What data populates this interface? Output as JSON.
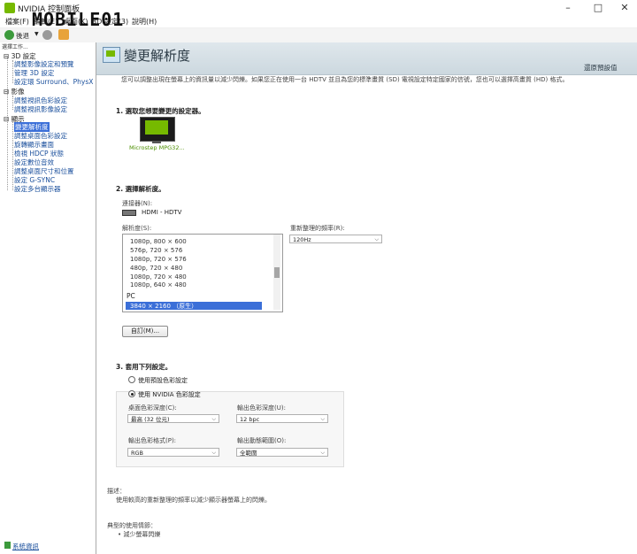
{
  "window": {
    "title": "NVIDIA 控制面板",
    "minimize": "–",
    "maximize": "□",
    "close": "✕"
  },
  "watermark": "MOBILE01",
  "menu": {
    "file": "檔案(F)",
    "edit": "編輯(E)",
    "view": "桌面(K)",
    "three_d": "3D 設定(3)",
    "help": "說明(H)"
  },
  "toolbar": {
    "back_label": "後退"
  },
  "sidebar": {
    "task_label": "選擇工作...",
    "categories": [
      {
        "label": "3D 設定",
        "items": [
          "調整影像設定和預覽",
          "管理 3D 設定",
          "設定環 Surround、PhysX"
        ]
      },
      {
        "label": "影像",
        "items": [
          "調整視訊色彩設定",
          "調整視訊影像設定"
        ]
      },
      {
        "label": "顯示",
        "items": [
          "變更解析度",
          "調整桌面色彩設定",
          "旋轉顯示畫面",
          "檢視 HDCP 狀態",
          "設定數位音效",
          "調整桌面尺寸和位置",
          "設定 G-SYNC",
          "設定多台顯示器"
        ]
      }
    ],
    "system_info": "系統資訊"
  },
  "main": {
    "title": "變更解析度",
    "restore_defaults": "還原預設值",
    "intro": "您可以調整出現在螢幕上的資訊量以減少閃爍。如果您正在使用一台 HDTV 並且為您的標準畫質 (SD) 電視設定特定國家的信號，您也可以選擇高畫質 (HD) 格式。",
    "section1": {
      "title": "1. 選取您想要變更的設定器。",
      "monitor_name": "Microstep MPG32..."
    },
    "section2": {
      "title": "2. 選擇解析度。",
      "connector_label": "連接器(N):",
      "connector_value": "HDMI - HDTV",
      "resolution_label": "解析度(S):",
      "resolutions": [
        "1080p, 800 × 600",
        "576p, 720 × 576",
        "1080p, 720 × 576",
        "480p, 720 × 480",
        "1080p, 720 × 480",
        "1080p, 640 × 480"
      ],
      "pc_group": "PC",
      "selected_resolution": "3840 × 2160 （原生）",
      "refresh_label": "重新整理的頻率(R):",
      "refresh_value": "120Hz",
      "customize_button": "自訂(M)..."
    },
    "section3": {
      "title": "3. 套用下列設定。",
      "radio_default": "使用預設色彩設定",
      "radio_nvidia": "使用 NVIDIA 色彩設定",
      "desktop_depth_label": "桌面色彩深度(C):",
      "desktop_depth_value": "最高 (32 位元)",
      "output_depth_label": "輸出色彩深度(U):",
      "output_depth_value": "12 bpc",
      "output_format_label": "輸出色彩格式(P):",
      "output_format_value": "RGB",
      "dynamic_range_label": "輸出動態範圍(O):",
      "dynamic_range_value": "全範圍"
    },
    "description": {
      "label": "描述：",
      "text": "使用較高的重新整理的頻率以減少顯示器螢幕上的閃爍。"
    },
    "usage": {
      "label": "典型的使用情節：",
      "item": "減少螢幕閃爍"
    }
  },
  "colors": {
    "nvidia_green": "#76b900",
    "selection_blue": "#3b6fd8",
    "link_blue": "#1a4f9c"
  }
}
